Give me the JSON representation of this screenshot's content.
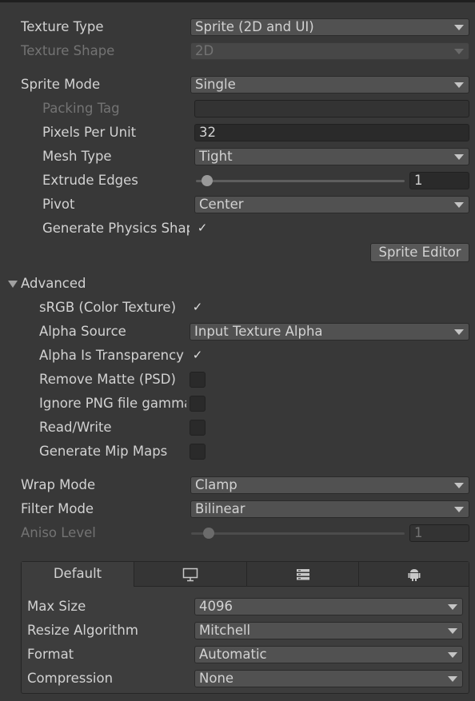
{
  "texture_type": {
    "label": "Texture Type",
    "value": "Sprite (2D and UI)"
  },
  "texture_shape": {
    "label": "Texture Shape",
    "value": "2D"
  },
  "sprite_mode": {
    "label": "Sprite Mode",
    "value": "Single"
  },
  "packing_tag": {
    "label": "Packing Tag",
    "value": ""
  },
  "pixels_per_unit": {
    "label": "Pixels Per Unit",
    "value": "32"
  },
  "mesh_type": {
    "label": "Mesh Type",
    "value": "Tight"
  },
  "extrude_edges": {
    "label": "Extrude Edges",
    "value": "1",
    "fraction": 0.03
  },
  "pivot": {
    "label": "Pivot",
    "value": "Center"
  },
  "generate_physics_shape": {
    "label": "Generate Physics Shape",
    "checked": true
  },
  "sprite_editor_button": "Sprite Editor",
  "advanced": {
    "label": "Advanced",
    "expanded": true,
    "srgb": {
      "label": "sRGB (Color Texture)",
      "checked": true
    },
    "alpha_source": {
      "label": "Alpha Source",
      "value": "Input Texture Alpha"
    },
    "alpha_is_transparency": {
      "label": "Alpha Is Transparency",
      "checked": true
    },
    "remove_matte": {
      "label": "Remove Matte (PSD)",
      "checked": false
    },
    "ignore_png_gamma": {
      "label": "Ignore PNG file gamma",
      "checked": false
    },
    "read_write": {
      "label": "Read/Write",
      "checked": false
    },
    "generate_mip_maps": {
      "label": "Generate Mip Maps",
      "checked": false
    }
  },
  "wrap_mode": {
    "label": "Wrap Mode",
    "value": "Clamp"
  },
  "filter_mode": {
    "label": "Filter Mode",
    "value": "Bilinear"
  },
  "aniso_level": {
    "label": "Aniso Level",
    "value": "1",
    "fraction": 0.06
  },
  "platform_tabs": [
    {
      "label": "Default",
      "icon": ""
    },
    {
      "icon": "monitor-icon"
    },
    {
      "icon": "server-icon"
    },
    {
      "icon": "android-icon"
    }
  ],
  "platform": {
    "max_size": {
      "label": "Max Size",
      "value": "4096"
    },
    "resize_algorithm": {
      "label": "Resize Algorithm",
      "value": "Mitchell"
    },
    "format": {
      "label": "Format",
      "value": "Automatic"
    },
    "compression": {
      "label": "Compression",
      "value": "None"
    }
  },
  "check_glyph": "✓"
}
